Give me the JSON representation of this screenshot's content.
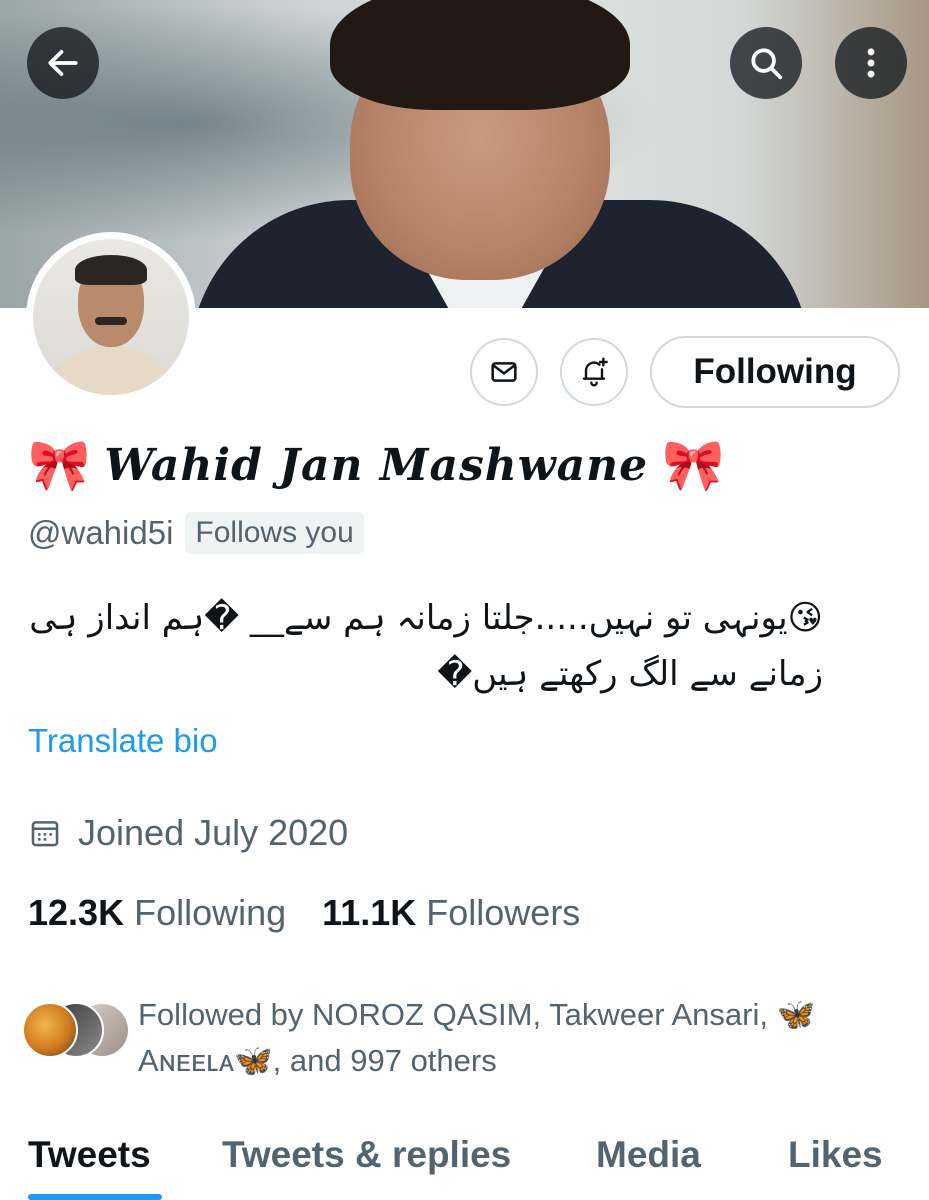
{
  "header": {
    "back_icon": "arrow-left-icon",
    "search_icon": "search-icon",
    "more_icon": "more-vertical-icon"
  },
  "profile": {
    "display_name": "Wahid Jan Mashwane",
    "name_emoji_left": "🎀",
    "name_emoji_right": "🎀",
    "handle": "@wahid5i",
    "follows_you": "Follows you",
    "bio_line1": "😘یونہی تو نہیں.....جلتا زمانہ ہم سے__ �ہم انداز ہی",
    "bio_line2": "زمانے سے الگ رکھتے ہیں�",
    "translate_bio": "Translate bio",
    "joined": "Joined July 2020",
    "following_count": "12.3K",
    "following_label": "Following",
    "followers_count": "11.1K",
    "followers_label": "Followers",
    "followed_by_line1": "Followed by NOROZ QASIM, Takweer Ansari, 🦋",
    "followed_by_line2": "Aɴᴇᴇʟᴀ🦋, and 997 others"
  },
  "actions": {
    "message_icon": "envelope-icon",
    "notify_icon": "bell-plus-icon",
    "follow_button": "Following"
  },
  "tabs": [
    {
      "label": "Tweets",
      "active": true
    },
    {
      "label": "Tweets & replies",
      "active": false
    },
    {
      "label": "Media",
      "active": false
    },
    {
      "label": "Likes",
      "active": false
    }
  ],
  "colors": {
    "accent": "#1d9bf0",
    "text": "#0f1419",
    "secondary_text": "#536471",
    "border": "#cfd9de"
  }
}
